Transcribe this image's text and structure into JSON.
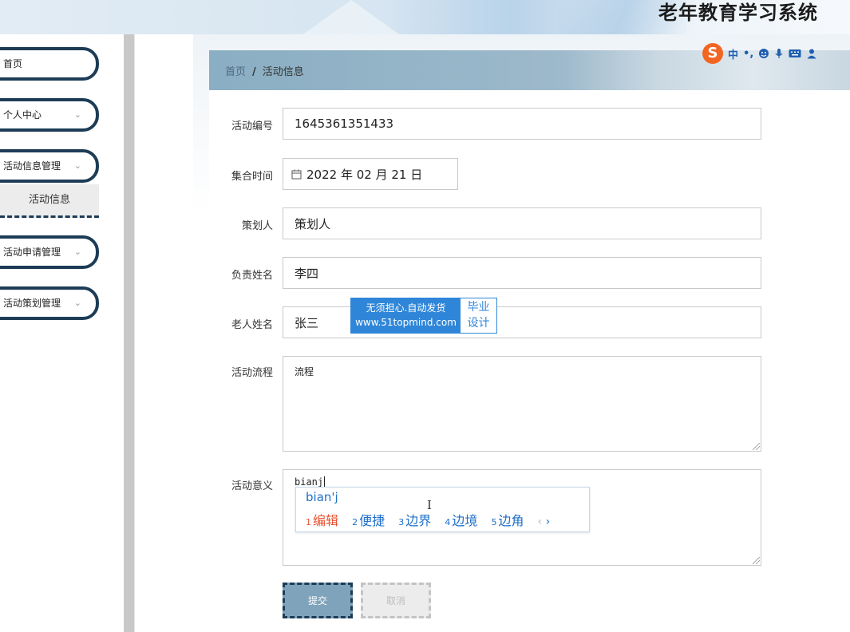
{
  "header": {
    "system_title": "老年教育学习系统"
  },
  "sidebar": {
    "items": [
      {
        "label": "首页",
        "has_chevron": false
      },
      {
        "label": "个人中心",
        "has_chevron": true
      },
      {
        "label": "活动信息管理",
        "has_chevron": true
      },
      {
        "label": "活动申请管理",
        "has_chevron": true
      },
      {
        "label": "活动策划管理",
        "has_chevron": true
      }
    ],
    "active_submenu": "活动信息",
    "chevron": "⌄"
  },
  "breadcrumb": {
    "home": "首页",
    "separator": "/",
    "current": "活动信息"
  },
  "ime_toolbar": {
    "logo": "S",
    "mode": "中",
    "punct": "•,",
    "icons": [
      "emoji-icon",
      "mic-icon",
      "keyboard-icon",
      "user-icon"
    ]
  },
  "form": {
    "fields": {
      "activity_id": {
        "label": "活动编号",
        "value": "1645361351433"
      },
      "gather_time": {
        "label": "集合时间",
        "value": "2022 年 02 月 21 日",
        "icon": "calendar-icon"
      },
      "planner": {
        "label": "策划人",
        "value": "策划人"
      },
      "manager_name": {
        "label": "负责姓名",
        "value": "李四"
      },
      "elder_name": {
        "label": "老人姓名",
        "value": "张三"
      },
      "process": {
        "label": "活动流程",
        "value": "流程"
      },
      "meaning": {
        "label": "活动意义",
        "value": "bianj"
      }
    },
    "submit_label": "提交",
    "cancel_label": "取消"
  },
  "watermark": {
    "line1": "无须担心.自动发货",
    "line2": "www.51topmind.com",
    "right1": "毕业",
    "right2": "设计"
  },
  "ime_popup": {
    "composition": "bian'j",
    "candidates": [
      {
        "n": "1",
        "text": "编辑"
      },
      {
        "n": "2",
        "text": "便捷"
      },
      {
        "n": "3",
        "text": "边界"
      },
      {
        "n": "4",
        "text": "边境"
      },
      {
        "n": "5",
        "text": "边角"
      }
    ],
    "prev": "‹",
    "next": "›"
  },
  "colors": {
    "navy": "#1d3c56",
    "breadcrumb_bg": "#8aaec3",
    "submit_bg": "#7fa3bb",
    "ime_blue": "#1f6fc8",
    "ime_first": "#e8502e"
  }
}
